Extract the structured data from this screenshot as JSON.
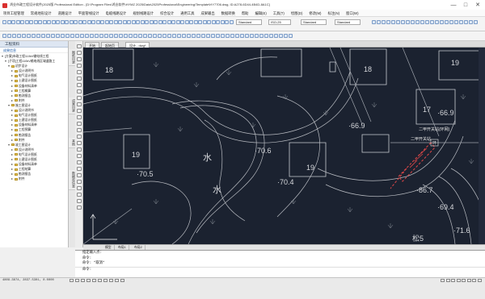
{
  "window": {
    "title": "鸿业市政工程设计软件(2025版 Professional Edition - [D:\\Program Files\\鸿业软件\\HYMZ 2025\\Data\\2025Professional\\Engineering\\Template\\HY7706.dwg, ID:A278-6D44-4B4D-8A1C]",
    "minimize": "—",
    "maximize": "□",
    "close": "✕"
  },
  "menu": [
    "项目工程管理",
    "常规地形设计",
    "道路设计",
    "平面管线设计",
    "电缆线路设计",
    "规划线路设计",
    "综合设计",
    "通用工具",
    "成果输出",
    "数据转换",
    "帮助",
    "编辑(E)",
    "工具(T)",
    "绘图(D)",
    "修改(M)",
    "标注(N)",
    "窗口(W)"
  ],
  "toolbar": {
    "layer_select": "Standard",
    "style_select": "ISO-25",
    "text_select": "Standard",
    "dim_select": "Standard"
  },
  "panel": {
    "title": "工程资料",
    "subtitle": "成果信息",
    "tree": [
      {
        "level": 0,
        "label": "[方案]市政工程110kV输电线工程",
        "expanded": true
      },
      {
        "level": 1,
        "label": "[子项]工程110kV输电线区域道路工",
        "expanded": true
      },
      {
        "level": 2,
        "label": "初步设计",
        "expanded": true,
        "folder": true
      },
      {
        "level": 3,
        "label": "设计说明书",
        "folder": true
      },
      {
        "level": 3,
        "label": "电气设计图纸",
        "folder": true
      },
      {
        "level": 3,
        "label": "土建设计图纸",
        "folder": true
      },
      {
        "level": 3,
        "label": "设备材料清单",
        "folder": true
      },
      {
        "level": 3,
        "label": "工程概算",
        "folder": true
      },
      {
        "level": 3,
        "label": "勘测报告",
        "folder": true
      },
      {
        "level": 3,
        "label": "附件",
        "folder": true
      },
      {
        "level": 2,
        "label": "施工图设计",
        "expanded": true,
        "folder": true
      },
      {
        "level": 3,
        "label": "设计说明书",
        "folder": true
      },
      {
        "level": 3,
        "label": "电气设计图纸",
        "folder": true
      },
      {
        "level": 3,
        "label": "土建设计图纸",
        "folder": true
      },
      {
        "level": 3,
        "label": "设备材料清单",
        "folder": true
      },
      {
        "level": 3,
        "label": "工程预算",
        "folder": true
      },
      {
        "level": 3,
        "label": "勘测报告",
        "folder": true
      },
      {
        "level": 3,
        "label": "附件",
        "folder": true
      },
      {
        "level": 2,
        "label": "竣工图设计",
        "expanded": true,
        "folder": true
      },
      {
        "level": 3,
        "label": "设计说明书",
        "folder": true
      },
      {
        "level": 3,
        "label": "电气设计图纸",
        "folder": true
      },
      {
        "level": 3,
        "label": "土建设计图纸",
        "folder": true
      },
      {
        "level": 3,
        "label": "设备材料清单",
        "folder": true
      },
      {
        "level": 3,
        "label": "工程结算",
        "folder": true
      },
      {
        "level": 3,
        "label": "勘测报告",
        "folder": true
      },
      {
        "level": 3,
        "label": "附件",
        "folder": true
      }
    ]
  },
  "vtabs": [
    "图纸目录",
    "成果目录",
    "其他",
    "数据库信息"
  ],
  "doc_tabs": [
    "开始",
    "起始页",
    "设计 - dwg*"
  ],
  "model_tabs": [
    "模型",
    "布局1",
    "布局2"
  ],
  "drawing": {
    "elevations": [
      "·66.9",
      "·70.6",
      "·70.5",
      "·70.4",
      "·86.7",
      "·66.9",
      "·69.4",
      "·71.6"
    ],
    "numbers": [
      "18",
      "18",
      "19",
      "19",
      "19",
      "17"
    ],
    "water": [
      "水",
      "水"
    ],
    "annotations": [
      "二甲开关站(环网)",
      "二甲开关站",
      "松5"
    ],
    "label_box": "环"
  },
  "command": {
    "line1": "指定输入点:",
    "line2": "命令:",
    "line3": "命令: *取消*",
    "prompt": "命令:"
  },
  "status": {
    "coords": "4809.3874, 2837.5301, 0.0000"
  }
}
